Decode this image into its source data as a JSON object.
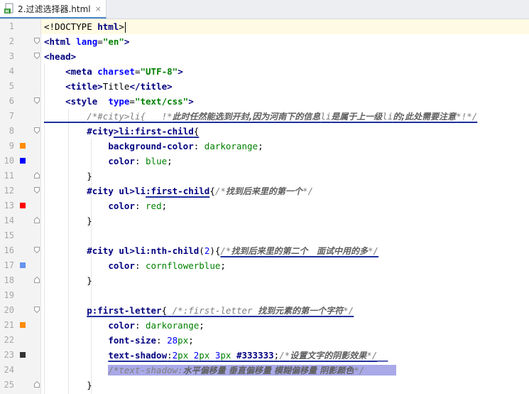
{
  "tab": {
    "title": "2.过滤选择器.html",
    "close": "×"
  },
  "colors": {
    "swatch_darkorange": "#ff8c00",
    "swatch_blue": "#0000ff",
    "swatch_red": "#ff0000",
    "swatch_cornflowerblue": "#6495ed",
    "swatch_333": "#333333"
  },
  "lines": {
    "l1": {
      "num": "1",
      "doctype": "<!DOCTYPE",
      "html": " html",
      "close": ">"
    },
    "l2": {
      "num": "2",
      "open": "<html",
      "attr": " lang",
      "eq": "=",
      "val": "\"en\"",
      "close": ">"
    },
    "l3": {
      "num": "3",
      "text": "<head>"
    },
    "l4": {
      "num": "4",
      "open": "<meta",
      "attr": " charset",
      "eq": "=",
      "val": "\"UTF-8\"",
      "close": ">"
    },
    "l5": {
      "num": "5",
      "open": "<title>",
      "text": "Title",
      "close": "</title>"
    },
    "l6": {
      "num": "6",
      "open": "<style",
      "attr": "  type",
      "eq": "=",
      "val": "\"text/css\"",
      "close": ">"
    },
    "l7": {
      "num": "7",
      "cm_start": "/*#city>li{   !*",
      "cm_cjk1": "此时任然能选到开封,因为河南下的信息",
      "cm_mid": "li",
      "cm_cjk2": "是属于上一级",
      "cm_mid2": "li",
      "cm_cjk3": "的;此处需要注意",
      "cm_end": "*!*/"
    },
    "l8": {
      "num": "8",
      "sel_id": "#city",
      "sel_rest": ">li",
      "pseudo": ":first-child",
      "brace": "{"
    },
    "l9": {
      "num": "9",
      "prop": "background-color",
      "colon": ": ",
      "val": "darkorange",
      "semi": ";"
    },
    "l10": {
      "num": "10",
      "prop": "color",
      "colon": ": ",
      "val": "blue",
      "semi": ";"
    },
    "l11": {
      "num": "11",
      "text": "}"
    },
    "l12": {
      "num": "12",
      "sel_id": "#city",
      "sel_rest": " ul>li",
      "pseudo": ":first-child",
      "brace": "{",
      "cm_start": "/*",
      "cm_cjk": "找到后来里的第一个",
      "cm_end": "*/"
    },
    "l13": {
      "num": "13",
      "prop": "color",
      "colon": ": ",
      "val": "red",
      "semi": ";"
    },
    "l14": {
      "num": "14",
      "text": "}"
    },
    "l15": {
      "num": "15"
    },
    "l16": {
      "num": "16",
      "sel_id": "#city",
      "sel_rest": " ul>li",
      "pseudo": ":nth-child",
      "arg_open": "(",
      "arg": "2",
      "arg_close": ")",
      "brace": "{",
      "cm_start": "/*",
      "cm_cjk": "找到后来里的第二个   面试中用的多",
      "cm_end": "*/"
    },
    "l17": {
      "num": "17",
      "prop": "color",
      "colon": ": ",
      "val": "cornflowerblue",
      "semi": ";"
    },
    "l18": {
      "num": "18",
      "text": "}"
    },
    "l19": {
      "num": "19"
    },
    "l20": {
      "num": "20",
      "sel_id": "p",
      "pseudo": ":first-letter",
      "brace": "{",
      "cm_start": " /*:first-letter ",
      "cm_cjk": "找到元素的第一个字符",
      "cm_end": "*/"
    },
    "l21": {
      "num": "21",
      "prop": "color",
      "colon": ": ",
      "val": "darkorange",
      "semi": ";"
    },
    "l22": {
      "num": "22",
      "prop": "font-size",
      "colon": ": ",
      "num_val": "28",
      "unit": "px",
      "semi": ";"
    },
    "l23": {
      "num": "23",
      "prop": "text-shadow",
      "colon": ":",
      "v1": "2",
      "u1": "px ",
      "v2": "2",
      "u2": "px ",
      "v3": "3",
      "u3": "px ",
      "color": "#333333",
      "semi": ";",
      "cm_start": "/*",
      "cm_cjk": "设置文字的阴影效果",
      "cm_end": "*/"
    },
    "l24": {
      "num": "24",
      "cm_start": "/*text-shadow:",
      "cm_cjk": "水平偏移量 垂直偏移量 模糊偏移量 阴影颜色",
      "cm_end": "*/"
    },
    "l25": {
      "num": "25",
      "text": "}"
    }
  }
}
